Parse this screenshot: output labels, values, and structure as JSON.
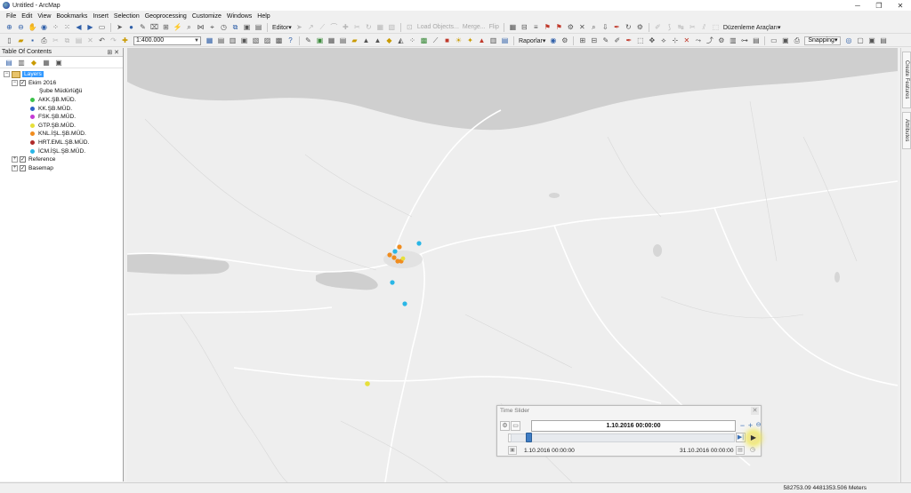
{
  "window": {
    "title": "Untitled - ArcMap",
    "buttons": {
      "minimize": "─",
      "restore": "❐",
      "close": "✕"
    }
  },
  "menu": [
    "File",
    "Edit",
    "View",
    "Bookmarks",
    "Insert",
    "Selection",
    "Geoprocessing",
    "Customize",
    "Windows",
    "Help"
  ],
  "toolbar": {
    "editor_label": "Editor▾",
    "load_objects_label": "Load Objects...",
    "merge_label": "Merge...",
    "flip_label": "Flip",
    "duzenleme_label": "Düzenleme Araçları▾",
    "scale_value": "1:400.000",
    "raporlar_label": "Raporlar▾",
    "snapping_label": "Snapping▾"
  },
  "toc": {
    "title": "Table Of Contents",
    "pin": "⊞ ✕",
    "layers_label": "Layers",
    "group_label": "Ekim 2016",
    "legend_header": "Şube Müdürlüğü",
    "legend": [
      {
        "label": "AKK.ŞB.MÜD.",
        "color": "#3cc14a"
      },
      {
        "label": "KK.ŞB.MÜD.",
        "color": "#2e62c7"
      },
      {
        "label": "FSK.ŞB.MÜD.",
        "color": "#c43ad4"
      },
      {
        "label": "GTP.ŞB.MÜD.",
        "color": "#e6df3a"
      },
      {
        "label": "KNL.İŞL.ŞB.MÜD.",
        "color": "#f08c1e"
      },
      {
        "label": "HRT.EML.ŞB.MÜD.",
        "color": "#b02a2a"
      },
      {
        "label": "İCM.İŞL.ŞB.MÜD.",
        "color": "#29b6e6"
      }
    ],
    "reference_label": "Reference",
    "basemap_label": "Basemap"
  },
  "rightpanel": {
    "tab1": "Create Features",
    "tab2": "Attributes"
  },
  "timeslider": {
    "title": "Time Slider",
    "current_time": "1.10.2016 00:00:00",
    "start_time": "1.10.2016 00:00:00",
    "end_time": "31.10.2016 00:00:00",
    "thumb_position": 0.02
  },
  "status": {
    "coordinates": "582753.09  4481353.506 Meters"
  }
}
